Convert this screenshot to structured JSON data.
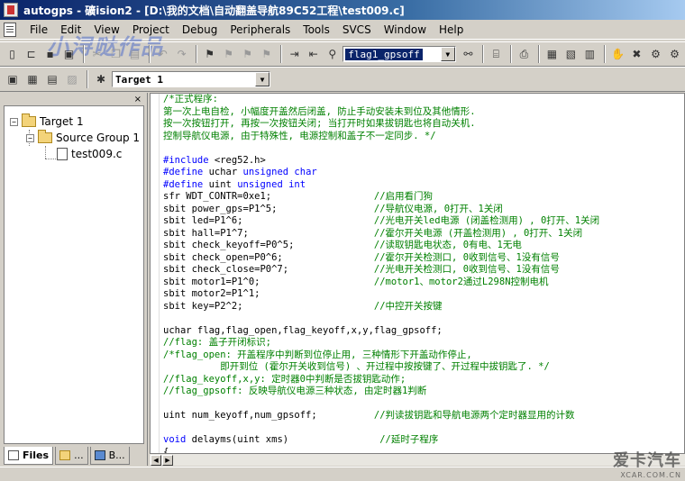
{
  "window": {
    "title": "autogps - 礦ision2 - [D:\\我的文档\\自动翻盖导航89C52工程\\test009.c]"
  },
  "menu": [
    {
      "label": "File"
    },
    {
      "label": "Edit"
    },
    {
      "label": "View"
    },
    {
      "label": "Project"
    },
    {
      "label": "Debug"
    },
    {
      "label": "Peripherals"
    },
    {
      "label": "Tools"
    },
    {
      "label": "SVCS"
    },
    {
      "label": "Window"
    },
    {
      "label": "Help"
    }
  ],
  "toolbar": {
    "find_combo_value": "flag1_gpsoff",
    "target_combo_value": "Target 1"
  },
  "watermark_text": "小浔哒作品",
  "project": {
    "tree": {
      "target": "Target 1",
      "group": "Source Group 1",
      "file": "test009.c"
    },
    "tabs": [
      {
        "label": "Files"
      },
      {
        "label": "..."
      },
      {
        "label": "B..."
      }
    ],
    "close_glyph": "×"
  },
  "code_lines": [
    [
      {
        "t": "cm",
        "s": "/*正式程序:"
      }
    ],
    [
      {
        "t": "cm",
        "s": "第一次上电自检, 小幅度开盖然后闭盖, 防止手动安装未到位及其他情形."
      }
    ],
    [
      {
        "t": "cm",
        "s": "按一次按钮打开, 再按一次按钮关闭; 当打开时如果拔钥匙也将自动关机."
      }
    ],
    [
      {
        "t": "cm",
        "s": "控制导航仪电源, 由于特殊性, 电源控制和盖子不一定同步. */"
      }
    ],
    [
      {
        "t": "tx",
        "s": ""
      }
    ],
    [
      {
        "t": "pp",
        "s": "#include"
      },
      {
        "t": "tx",
        "s": " <reg52.h>"
      }
    ],
    [
      {
        "t": "pp",
        "s": "#define"
      },
      {
        "t": "tx",
        "s": " uchar "
      },
      {
        "t": "kw",
        "s": "unsigned char"
      }
    ],
    [
      {
        "t": "pp",
        "s": "#define"
      },
      {
        "t": "tx",
        "s": " uint "
      },
      {
        "t": "kw",
        "s": "unsigned int"
      }
    ],
    [
      {
        "t": "tx",
        "s": "sfr WDT_CONTR=0xe1;                  "
      },
      {
        "t": "cm",
        "s": "//启用看门狗"
      }
    ],
    [
      {
        "t": "tx",
        "s": "sbit power_gps=P1^5;                 "
      },
      {
        "t": "cm",
        "s": "//导航仪电源, 0打开、1关闭"
      }
    ],
    [
      {
        "t": "tx",
        "s": "sbit led=P1^6;                       "
      },
      {
        "t": "cm",
        "s": "//光电开关led电源 (闭盖检测用) , 0打开、1关闭"
      }
    ],
    [
      {
        "t": "tx",
        "s": "sbit hall=P1^7;                      "
      },
      {
        "t": "cm",
        "s": "//霍尔开关电源 (开盖检测用) , 0打开、1关闭"
      }
    ],
    [
      {
        "t": "tx",
        "s": "sbit check_keyoff=P0^5;              "
      },
      {
        "t": "cm",
        "s": "//读取钥匙电状态, 0有电、1无电"
      }
    ],
    [
      {
        "t": "tx",
        "s": "sbit check_open=P0^6;                "
      },
      {
        "t": "cm",
        "s": "//霍尔开关检测口, 0收到信号、1没有信号"
      }
    ],
    [
      {
        "t": "tx",
        "s": "sbit check_close=P0^7;               "
      },
      {
        "t": "cm",
        "s": "//光电开关检测口, 0收到信号、1没有信号"
      }
    ],
    [
      {
        "t": "tx",
        "s": "sbit motor1=P1^0;                    "
      },
      {
        "t": "cm",
        "s": "//motor1、motor2通过L298N控制电机"
      }
    ],
    [
      {
        "t": "tx",
        "s": "sbit motor2=P1^1;"
      }
    ],
    [
      {
        "t": "tx",
        "s": "sbit key=P2^2;                       "
      },
      {
        "t": "cm",
        "s": "//中控开关按键"
      }
    ],
    [
      {
        "t": "tx",
        "s": ""
      }
    ],
    [
      {
        "t": "tx",
        "s": "uchar flag,flag_open,flag_keyoff,x,y,flag_gpsoff;"
      }
    ],
    [
      {
        "t": "cm",
        "s": "//flag: 盖子开闭标识;"
      }
    ],
    [
      {
        "t": "cm",
        "s": "/*flag_open: 开盖程序中判断到位停止用, 三种情形下开盖动作停止,"
      }
    ],
    [
      {
        "t": "cm",
        "s": "          即开到位 (霍尔开关收到信号) 、开过程中按按键了、开过程中拔钥匙了. */"
      }
    ],
    [
      {
        "t": "cm",
        "s": "//flag_keyoff,x,y: 定时器0中判断是否拔钥匙动作;"
      }
    ],
    [
      {
        "t": "cm",
        "s": "//flag_gpsoff: 反映导航仪电源三种状态, 由定时器1判断"
      }
    ],
    [
      {
        "t": "tx",
        "s": ""
      }
    ],
    [
      {
        "t": "tx",
        "s": "uint num_keyoff,num_gpsoff;          "
      },
      {
        "t": "cm",
        "s": "//判读拔钥匙和导航电源两个定时器显用的计数"
      }
    ],
    [
      {
        "t": "tx",
        "s": ""
      }
    ],
    [
      {
        "t": "kw",
        "s": "void"
      },
      {
        "t": "tx",
        "s": " delayms(uint xms)                "
      },
      {
        "t": "cm",
        "s": "//延时子程序"
      }
    ],
    [
      {
        "t": "tx",
        "s": "{"
      }
    ]
  ],
  "logo": {
    "big": "爱卡汽车",
    "small": "XCAR.COM.CN"
  }
}
